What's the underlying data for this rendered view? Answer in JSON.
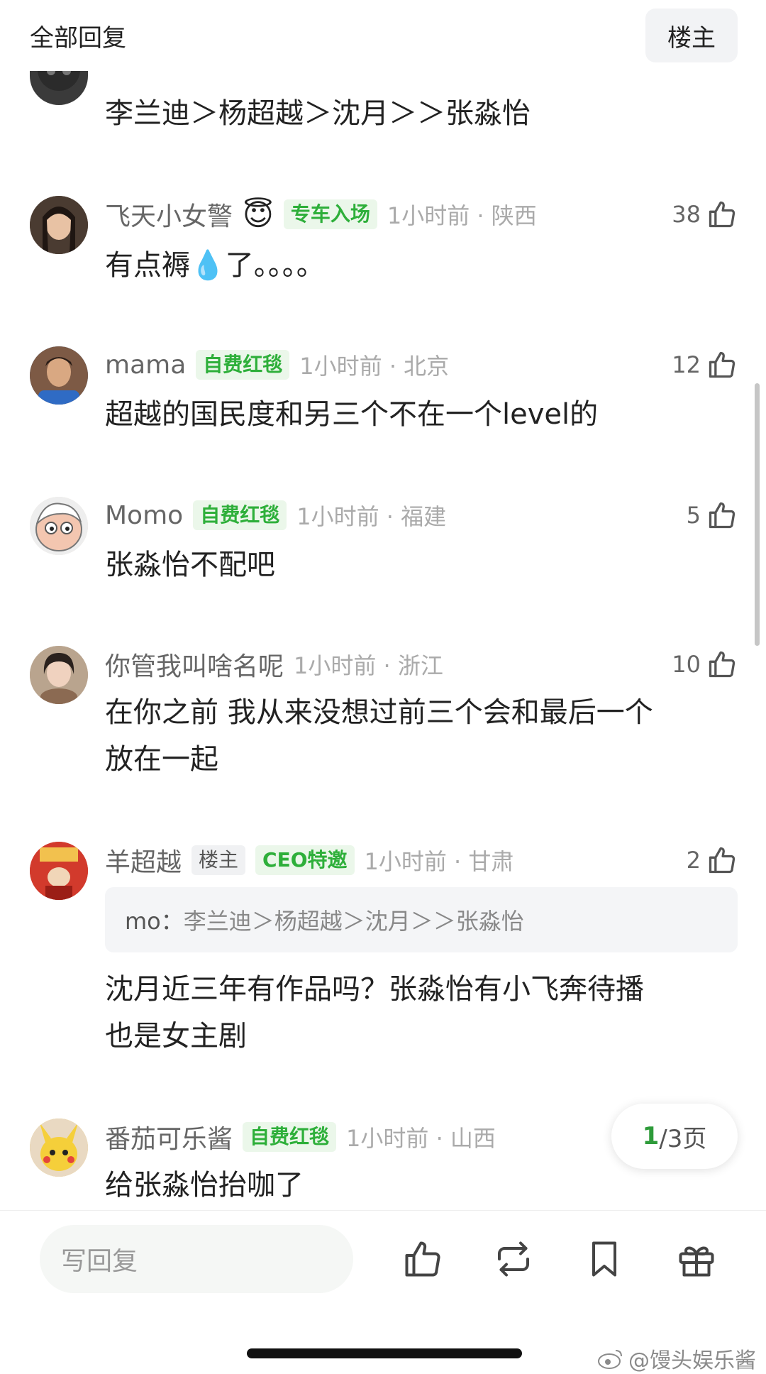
{
  "header": {
    "title": "全部回复",
    "op_button": "楼主"
  },
  "top_comment": {
    "text": "李兰迪＞杨超越＞沈月＞＞张淼怡"
  },
  "comments": [
    {
      "username": "飞天小女警",
      "emoji": "😇",
      "tags": [
        "专车入场"
      ],
      "time": "1小时前 · 陕西",
      "likes": "38",
      "text": "有点褥💧了。。。。"
    },
    {
      "username": "mama",
      "tags": [
        "自费红毯"
      ],
      "time": "1小时前 · 北京",
      "likes": "12",
      "text": "超越的国民度和另三个不在一个level的"
    },
    {
      "username": "Momo",
      "tags": [
        "自费红毯"
      ],
      "time": "1小时前 · 福建",
      "likes": "5",
      "text": "张淼怡不配吧"
    },
    {
      "username": "你管我叫啥名呢",
      "tags": [],
      "time": "1小时前 · 浙江",
      "likes": "10",
      "text_lines": [
        "在你之前 我从来没想过前三个会和最后一个",
        "放在一起"
      ]
    },
    {
      "username": "羊超越",
      "tags": [
        "楼主",
        "CEO特邀"
      ],
      "time": "1小时前 · 甘肃",
      "likes": "2",
      "quote": {
        "name": "mo：",
        "text": "李兰迪＞杨超越＞沈月＞＞张淼怡"
      },
      "text_lines": [
        "沈月近三年有作品吗？张淼怡有小飞奔待播",
        "也是女主剧"
      ]
    },
    {
      "username": "番茄可乐酱",
      "tags": [
        "自费红毯"
      ],
      "time": "1小时前 · 山西",
      "text": "给张淼怡抬咖了"
    }
  ],
  "pager": {
    "current": "1",
    "total": "/3页"
  },
  "bottom_bar": {
    "reply_placeholder": "写回复"
  },
  "watermark": "@馒头娱乐酱",
  "colors": {
    "accent_green": "#2eaf3a",
    "tag_bg": "#ebf7ea"
  }
}
